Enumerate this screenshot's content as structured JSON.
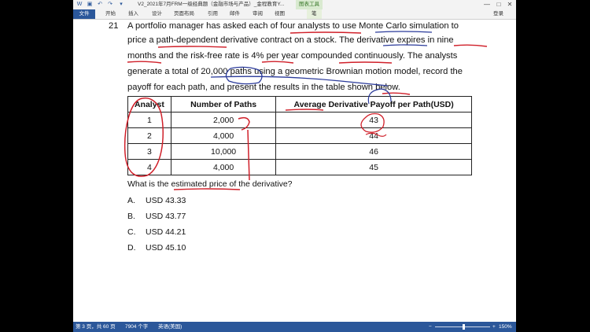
{
  "titlebar": {
    "doc_title": "V2_2021年7月FRM一级经典题（金融市场与产品）_金程教育Y...",
    "context_tab": "图表工具",
    "minimize": "—",
    "maximize": "□",
    "close": "✕"
  },
  "ribbon": {
    "file_tab": "文件",
    "tabs": [
      "开始",
      "插入",
      "设计",
      "页面布局",
      "引用",
      "邮件",
      "审阅",
      "视图"
    ],
    "extra_tab": "笔",
    "login": "登录"
  },
  "question": {
    "number": "21",
    "lines": [
      "A portfolio manager has asked each of four analysts to use Monte Carlo simulation to",
      "price a path-dependent derivative contract on a stock. The derivative expires in nine",
      "months and the risk-free rate is 4% per year compounded continuously. The analysts",
      "generate a total of 20,000 paths using a geometric Brownian motion model, record the",
      "payoff for each path, and present the results in the table shown below."
    ],
    "table": {
      "headers": [
        "Analyst",
        "Number of Paths",
        "Average Derivative Payoff per Path(USD)"
      ],
      "rows": [
        [
          "1",
          "2,000",
          "43"
        ],
        [
          "2",
          "4,000",
          "44"
        ],
        [
          "3",
          "10,000",
          "46"
        ],
        [
          "4",
          "4,000",
          "45"
        ]
      ]
    },
    "prompt": "What is the estimated price of the derivative?",
    "options": [
      {
        "letter": "A.",
        "text": "USD 43.33"
      },
      {
        "letter": "B.",
        "text": "USD 43.77"
      },
      {
        "letter": "C.",
        "text": "USD 44.21"
      },
      {
        "letter": "D.",
        "text": "USD 45.10"
      }
    ]
  },
  "statusbar": {
    "page": "第 3 页，共 60 页",
    "words": "7904 个字",
    "lang": "英语(美国)",
    "zoom": "150%",
    "zoom_minus": "−",
    "zoom_plus": "+"
  },
  "colors": {
    "ink_red": "#d0202a",
    "ink_blue": "#2a3a9a",
    "accent": "#2b579a"
  }
}
